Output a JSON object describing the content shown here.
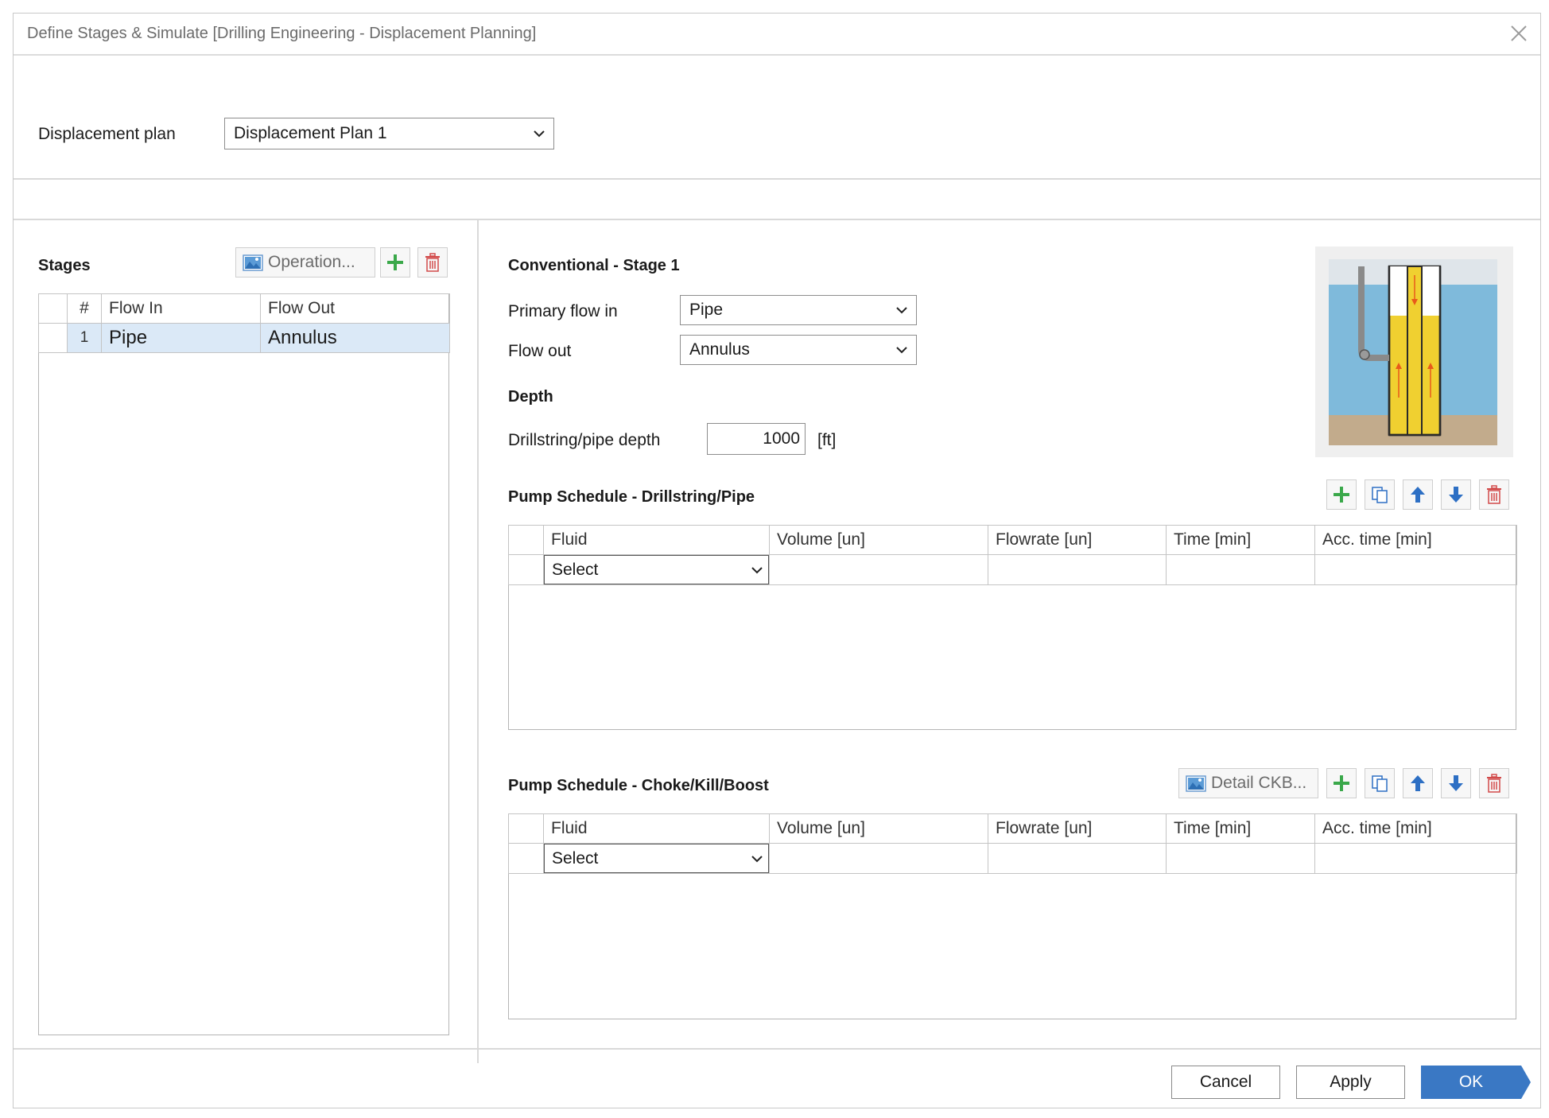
{
  "window": {
    "title": "Define Stages & Simulate [Drilling Engineering - Displacement Planning]"
  },
  "plan": {
    "label": "Displacement plan",
    "value": "Displacement Plan 1"
  },
  "stages": {
    "heading": "Stages",
    "operation_button": "Operation...",
    "columns": [
      "#",
      "Flow In",
      "Flow Out"
    ],
    "rows": [
      {
        "num": "1",
        "flow_in": "Pipe",
        "flow_out": "Annulus"
      }
    ]
  },
  "stage_detail": {
    "heading": "Conventional  - Stage 1",
    "primary_flow_in_label": "Primary flow in",
    "primary_flow_in_value": "Pipe",
    "flow_out_label": "Flow out",
    "flow_out_value": "Annulus",
    "depth_heading": "Depth",
    "depth_label": "Drillstring/pipe depth",
    "depth_value": "1000",
    "depth_unit": "[ft]"
  },
  "pump_pipe": {
    "heading": "Pump Schedule - Drillstring/Pipe",
    "columns": [
      "Fluid",
      "Volume [un]",
      "Flowrate [un]",
      "Time [min]",
      "Acc. time [min]"
    ],
    "select_value": "Select"
  },
  "pump_ckb": {
    "heading": "Pump Schedule - Choke/Kill/Boost",
    "detail_button": "Detail CKB...",
    "columns": [
      "Fluid",
      "Volume [un]",
      "Flowrate [un]",
      "Time [min]",
      "Acc. time [min]"
    ],
    "select_value": "Select"
  },
  "footer": {
    "cancel": "Cancel",
    "apply": "Apply",
    "ok": "OK"
  },
  "colors": {
    "accent": "#3a78c4",
    "selected_row": "#dbe9f7",
    "add_green": "#3aa84a",
    "delete_red": "#d24a4a",
    "arrow_blue": "#2d6fc4"
  }
}
